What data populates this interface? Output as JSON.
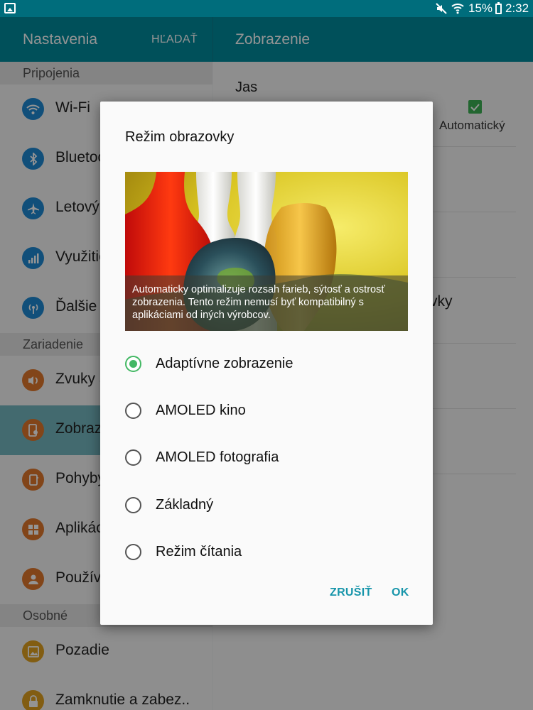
{
  "status_bar": {
    "battery": "15%",
    "time": "2:32"
  },
  "app_bar": {
    "title": "Nastavenia",
    "search_label": "HĽADAŤ",
    "detail_title": "Zobrazenie"
  },
  "sidebar": {
    "sections": [
      {
        "label": "Pripojenia"
      },
      {
        "label": "Zariadenie"
      },
      {
        "label": "Osobné"
      }
    ],
    "items": [
      {
        "label": "Wi-Fi",
        "icon": "wifi-icon",
        "color": "#1e88d2"
      },
      {
        "label": "Bluetooth",
        "icon": "bluetooth-icon",
        "color": "#1e88d2"
      },
      {
        "label": "Letový režim",
        "icon": "airplane-icon",
        "color": "#1e88d2"
      },
      {
        "label": "Využitie dát",
        "icon": "data-usage-icon",
        "color": "#1e88d2"
      },
      {
        "label": "Ďalšie siete",
        "icon": "more-networks-icon",
        "color": "#1e88d2"
      },
      {
        "label": "Zvuky a upozornenia",
        "icon": "sound-icon",
        "color": "#e0782c"
      },
      {
        "label": "Zobrazenie",
        "icon": "display-icon",
        "color": "#e0782c",
        "active": true
      },
      {
        "label": "Pohyby a gestá",
        "icon": "motion-icon",
        "color": "#e0782c"
      },
      {
        "label": "Aplikácie",
        "icon": "apps-icon",
        "color": "#e0782c"
      },
      {
        "label": "Používatelia",
        "icon": "users-icon",
        "color": "#e0782c"
      },
      {
        "label": "Pozadie",
        "icon": "wallpaper-icon",
        "color": "#e0a020"
      },
      {
        "label": "Zamknutie a zabez..",
        "icon": "lock-icon",
        "color": "#e0a020"
      }
    ]
  },
  "detail": {
    "brightness_label": "Jas",
    "auto_label": "Automatický",
    "partial_text": "vky"
  },
  "dialog": {
    "title": "Režim obrazovky",
    "preview_caption": "Automaticky optimalizuje rozsah farieb, sýtosť a ostrosť zobrazenia. Tento režim nemusí byť kompatibilný s aplikáciami od iných výrobcov.",
    "options": [
      {
        "label": "Adaptívne zobrazenie",
        "selected": true
      },
      {
        "label": "AMOLED kino",
        "selected": false
      },
      {
        "label": "AMOLED fotografia",
        "selected": false
      },
      {
        "label": "Základný",
        "selected": false
      },
      {
        "label": "Režim čítania",
        "selected": false
      }
    ],
    "cancel_label": "ZRUŠIŤ",
    "ok_label": "OK",
    "accent_color": "#43b864"
  }
}
